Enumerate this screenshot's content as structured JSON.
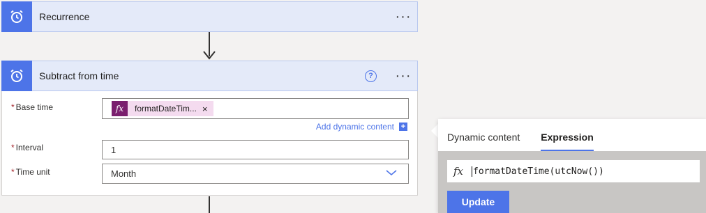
{
  "recurrence": {
    "title": "Recurrence",
    "menu": "···"
  },
  "subtract": {
    "title": "Subtract from time",
    "help": "?",
    "menu": "···",
    "base_time": {
      "label": "Base time",
      "required": "*",
      "token_icon": "fx",
      "token_label": "formatDateTim...",
      "token_remove": "×"
    },
    "add_dynamic": {
      "label": "Add dynamic content",
      "plus": "+"
    },
    "interval": {
      "label": "Interval",
      "required": "*",
      "value": "1"
    },
    "time_unit": {
      "label": "Time unit",
      "required": "*",
      "value": "Month"
    }
  },
  "panel": {
    "tabs": [
      {
        "label": "Dynamic content",
        "active": false
      },
      {
        "label": "Expression",
        "active": true
      }
    ],
    "fx_icon": "fx",
    "expression": "formatDateTime(utcNow())",
    "update_label": "Update"
  },
  "colors": {
    "accent": "#4d74e8",
    "header_bg": "#e4eaf9",
    "token_bg": "#f4dbef",
    "token_icon_bg": "#7a1f6e"
  },
  "icons": [
    "alarm-clock-icon",
    "more-icon",
    "help-icon",
    "fx-icon",
    "chevron-down-icon",
    "plus-icon",
    "arrow-down-icon"
  ]
}
